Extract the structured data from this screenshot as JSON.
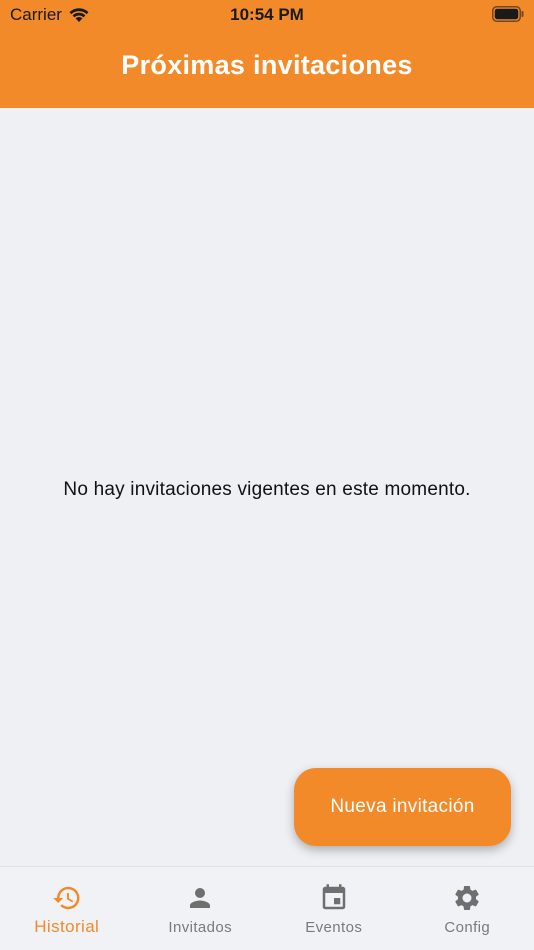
{
  "status_bar": {
    "carrier": "Carrier",
    "time": "10:54 PM"
  },
  "header": {
    "title": "Próximas invitaciones"
  },
  "empty_state": {
    "message": "No hay invitaciones vigentes en este momento."
  },
  "fab": {
    "label": "Nueva invitación"
  },
  "tab_bar": {
    "items": [
      {
        "label": "Historial",
        "icon": "history-icon",
        "active": true
      },
      {
        "label": "Invitados",
        "icon": "person-icon",
        "active": false
      },
      {
        "label": "Eventos",
        "icon": "calendar-icon",
        "active": false
      },
      {
        "label": "Config",
        "icon": "gear-icon",
        "active": false
      }
    ]
  },
  "colors": {
    "accent": "#f28a2a",
    "background": "#eff0f4",
    "tab_inactive": "#6f6f6f"
  }
}
